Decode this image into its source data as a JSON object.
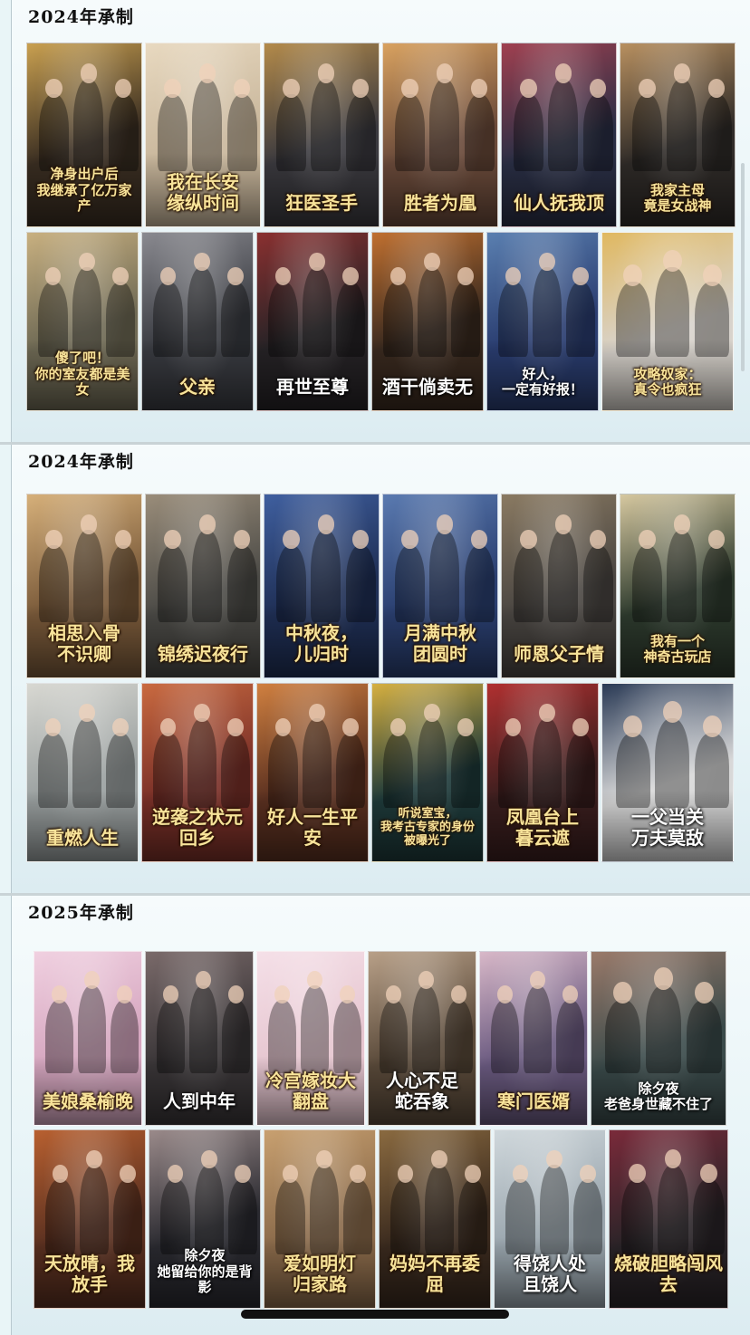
{
  "sections": [
    {
      "title": "2024年承制",
      "rows": [
        [
          {
            "title": "净身出户后\n我继承了亿万家产",
            "bg": "#3a2e22",
            "accent": "#c9a050"
          },
          {
            "title": "我在长安\n缘纵时间",
            "bg": "#c9b79c",
            "accent": "#e8d9c0"
          },
          {
            "title": "狂医圣手",
            "bg": "#3b3a3f",
            "accent": "#b38a4a"
          },
          {
            "title": "胜者为凰",
            "bg": "#6a4a3a",
            "accent": "#d9a260"
          },
          {
            "title": "仙人抚我顶",
            "bg": "#2a2f45",
            "accent": "#a04050"
          },
          {
            "title": "我家主母\n竟是女战神",
            "bg": "#2f2b28",
            "accent": "#b89060"
          }
        ],
        [
          {
            "title": "傻了吧！\n你的室友都是美女",
            "bg": "#6f6a55",
            "accent": "#c8b080"
          },
          {
            "title": "父亲",
            "bg": "#3a3c42",
            "accent": "#8a8a90"
          },
          {
            "title": "再世至尊",
            "bg": "#262326",
            "accent": "#8a3030",
            "white": true
          },
          {
            "title": "酒干倘卖无",
            "bg": "#3a2a1f",
            "accent": "#c07030",
            "white": true
          },
          {
            "title": "好人，\n一定有好报！",
            "bg": "#2a3d70",
            "accent": "#5a7fb0",
            "white": true
          },
          {
            "title": "攻略奴家：\n真令也疯狂",
            "bg": "#d8d3cc",
            "accent": "#e0b860"
          }
        ]
      ]
    },
    {
      "title": "2024年承制",
      "rows": [
        [
          {
            "title": "相思入骨\n不识卿",
            "bg": "#7a5a3a",
            "accent": "#d6b07a"
          },
          {
            "title": "锦绣迟夜行",
            "bg": "#4b4a46",
            "accent": "#9a8d7a"
          },
          {
            "title": "中秋夜，\n儿归时",
            "bg": "#1f2f55",
            "accent": "#3f5f9f"
          },
          {
            "title": "月满中秋\n团圆时",
            "bg": "#2a3f70",
            "accent": "#5a7ab0"
          },
          {
            "title": "师恩父子情",
            "bg": "#4a4642",
            "accent": "#8a7a62"
          },
          {
            "title": "我有一个\n神奇古玩店",
            "bg": "#2e3b2e",
            "accent": "#d6c8a0"
          }
        ],
        [
          {
            "title": "重燃人生",
            "bg": "#9aa0a0",
            "accent": "#d8d8d2"
          },
          {
            "title": "逆袭之状元回乡",
            "bg": "#7a3028",
            "accent": "#c96a40"
          },
          {
            "title": "好人一生平安",
            "bg": "#5a3020",
            "accent": "#d08040"
          },
          {
            "title": "听说室宝，\n我考古专家的身份\n被曝光了",
            "bg": "#1e3a3a",
            "accent": "#d6b040"
          },
          {
            "title": "凤凰台上\n暮云遮",
            "bg": "#3a1e1e",
            "accent": "#b03030"
          },
          {
            "title": "一父当关\n万夫莫敌",
            "bg": "#d8d8d8",
            "accent": "#2a3a55",
            "white": true
          }
        ]
      ]
    },
    {
      "title": "2025年承制",
      "rows": [
        [
          {
            "title": "美娘桑榆晚",
            "bg": "#d6a7c0",
            "accent": "#f0d0e0"
          },
          {
            "title": "人到中年",
            "bg": "#3a3638",
            "accent": "#7a6a6a",
            "white": true
          },
          {
            "title": "冷宫嫁妆大翻盘",
            "bg": "#e6c6d0",
            "accent": "#f5e0e8"
          },
          {
            "title": "人心不足\n蛇吞象",
            "bg": "#5a4a3a",
            "accent": "#b8a088",
            "white": true
          },
          {
            "title": "寒门医婿",
            "bg": "#6a5a80",
            "accent": "#d8b8c8"
          },
          {
            "title": "除夕夜\n老爸身世藏不住了",
            "bg": "#3a4a4a",
            "accent": "#9a7a6a",
            "white": true
          }
        ],
        [
          {
            "title": "天放晴，我放手",
            "bg": "#5a3020",
            "accent": "#b86030"
          },
          {
            "title": "除夕夜\n她留给你的是背影",
            "bg": "#2a2a30",
            "accent": "#9a8a8a",
            "white": true
          },
          {
            "title": "爱如明灯\n归家路",
            "bg": "#8a6a4a",
            "accent": "#c8a070"
          },
          {
            "title": "妈妈不再委屈",
            "bg": "#3a2a1e",
            "accent": "#8a6a40"
          },
          {
            "title": "得饶人处\n且饶人",
            "bg": "#9aa6ae",
            "accent": "#d0d8dc",
            "white": true
          },
          {
            "title": "烧破胆略闯风去",
            "bg": "#2a2428",
            "accent": "#7a2a3a"
          }
        ]
      ]
    }
  ]
}
